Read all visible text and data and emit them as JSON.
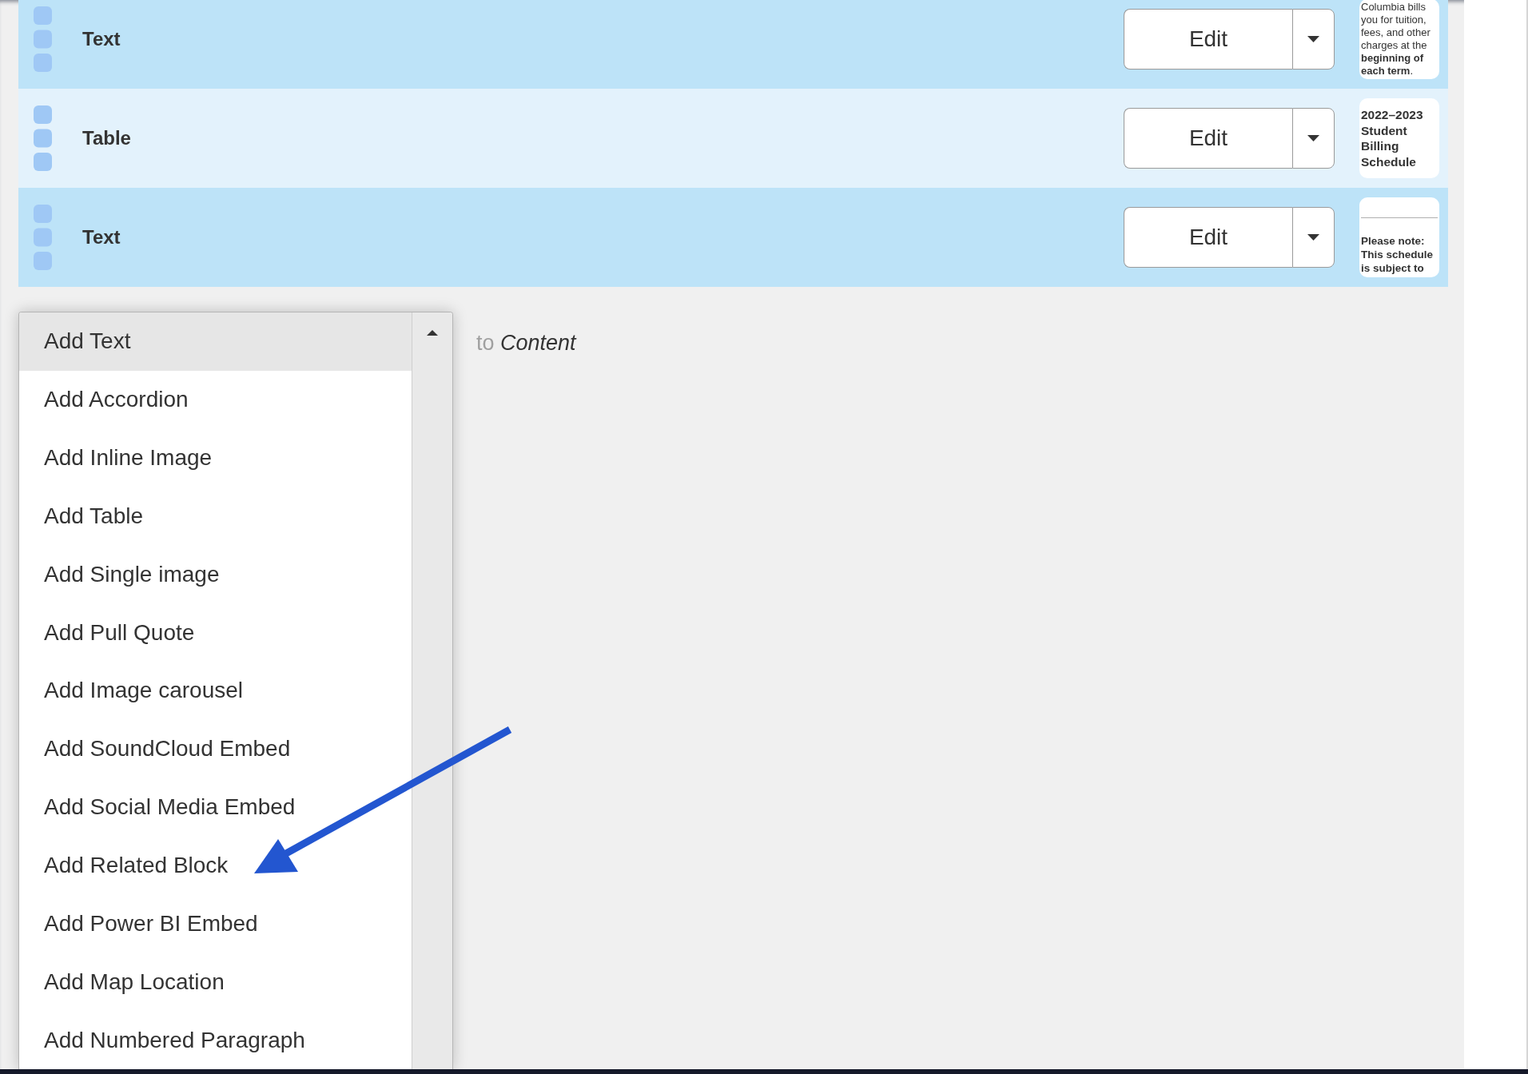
{
  "blocks": [
    {
      "label": "Text",
      "edit_button": "Edit",
      "kind": "paragraph",
      "preview": "Columbia bills you for tuition, fees, and other charges at the **beginning of each term**."
    },
    {
      "label": "Table",
      "edit_button": "Edit",
      "kind": "heading",
      "preview": "2022–2023 Student Billing Schedule"
    },
    {
      "label": "Text",
      "edit_button": "Edit",
      "kind": "note",
      "preview": "Please note: This schedule is subject to"
    }
  ],
  "add_menu": {
    "items": [
      {
        "label": "Add Text",
        "selected": true
      },
      {
        "label": "Add Accordion",
        "selected": false
      },
      {
        "label": "Add Inline Image",
        "selected": false
      },
      {
        "label": "Add Table",
        "selected": false
      },
      {
        "label": "Add Single image",
        "selected": false
      },
      {
        "label": "Add Pull Quote",
        "selected": false
      },
      {
        "label": "Add Image carousel",
        "selected": false
      },
      {
        "label": "Add SoundCloud Embed",
        "selected": false
      },
      {
        "label": "Add Social Media Embed",
        "selected": false
      },
      {
        "label": "Add Related Block",
        "selected": false
      },
      {
        "label": "Add Power BI Embed",
        "selected": false
      },
      {
        "label": "Add Map Location",
        "selected": false
      },
      {
        "label": "Add Numbered Paragraph",
        "selected": false
      }
    ],
    "trailing_text": "to *Content*"
  }
}
